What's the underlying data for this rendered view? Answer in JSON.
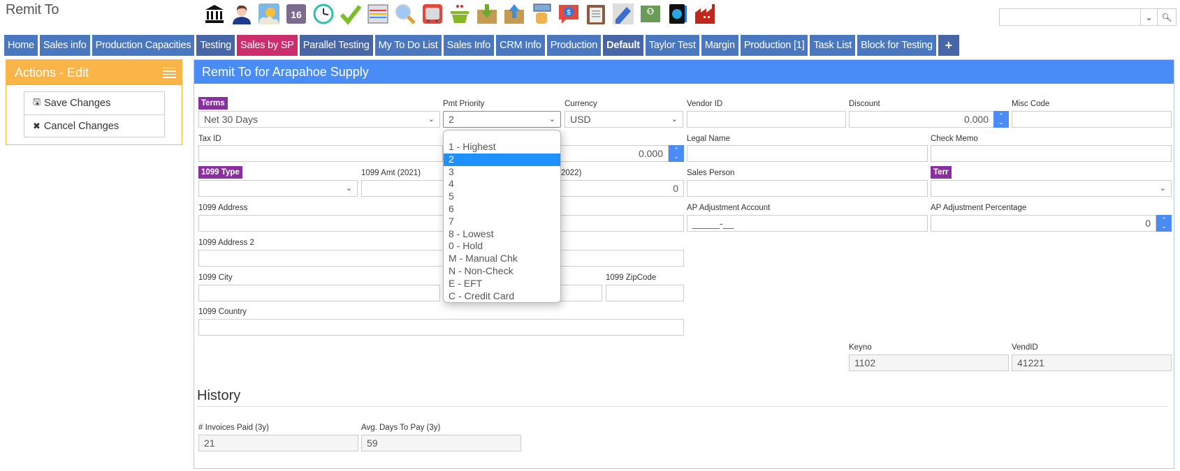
{
  "page_title": "Remit To",
  "toolbar_icons": [
    {
      "name": "bank-icon"
    },
    {
      "name": "user-icon"
    },
    {
      "name": "weather-icon"
    },
    {
      "name": "calendar-icon",
      "text": "16"
    },
    {
      "name": "clock-icon"
    },
    {
      "name": "checkmark-icon"
    },
    {
      "name": "schedule-board-icon"
    },
    {
      "name": "magnifier-icon"
    },
    {
      "name": "truck-icon"
    },
    {
      "name": "basket-icon"
    },
    {
      "name": "inbox-download-icon"
    },
    {
      "name": "outbox-upload-icon"
    },
    {
      "name": "hand-alert-icon"
    },
    {
      "name": "dollar-chat-icon"
    },
    {
      "name": "clipboard-icon"
    },
    {
      "name": "pencil-icon"
    },
    {
      "name": "money-icon"
    },
    {
      "name": "time-tablet-icon"
    },
    {
      "name": "factory-icon"
    }
  ],
  "search": {
    "value": "",
    "placeholder": ""
  },
  "tabs": [
    {
      "label": "Home"
    },
    {
      "label": "Sales info"
    },
    {
      "label": "Production Capacities"
    },
    {
      "label": "Testing"
    },
    {
      "label": "Sales by SP"
    },
    {
      "label": "Parallel Testing"
    },
    {
      "label": "My To Do List"
    },
    {
      "label": "Sales Info"
    },
    {
      "label": "CRM Info"
    },
    {
      "label": "Production"
    },
    {
      "label": "Default"
    },
    {
      "label": "Taylor Test"
    },
    {
      "label": "Margin"
    },
    {
      "label": "Production [1]"
    },
    {
      "label": "Task List"
    },
    {
      "label": "Block for Testing"
    },
    {
      "label": "+"
    }
  ],
  "actions": {
    "title": "Actions - Edit",
    "items": [
      {
        "label": "Save Changes",
        "icon": "save-icon"
      },
      {
        "label": "Cancel Changes",
        "icon": "close-icon"
      }
    ]
  },
  "form": {
    "title": "Remit To for Arapahoe Supply",
    "terms": {
      "label": "Terms",
      "value": "Net 30 Days"
    },
    "pmt_priority": {
      "label": "Pmt Priority",
      "value": "2",
      "options": [
        "",
        "1 - Highest",
        "2",
        "3",
        "4",
        "5",
        "6",
        "7",
        "8 - Lowest",
        "0 - Hold",
        "M - Manual Chk",
        "N - Non-Check",
        "E - EFT",
        "C - Credit Card"
      ],
      "selected_index": 2
    },
    "currency": {
      "label": "Currency",
      "value": "USD"
    },
    "vendor_id": {
      "label": "Vendor ID",
      "value": ""
    },
    "discount": {
      "label": "Discount",
      "value": "0.000"
    },
    "misc_code": {
      "label": "Misc Code",
      "value": ""
    },
    "tax_id": {
      "label": "Tax ID",
      "value": ""
    },
    "hidden_numeric": {
      "value": "0.000"
    },
    "legal_name": {
      "label": "Legal Name",
      "value": ""
    },
    "check_memo": {
      "label": "Check Memo",
      "value": ""
    },
    "type_1099": {
      "label": "1099 Type",
      "value": ""
    },
    "amt_1099_2021": {
      "label": "1099 Amt (2021)",
      "value": ""
    },
    "amt_1099_2022": {
      "label": "2022)",
      "value": "0"
    },
    "sales_person": {
      "label": "Sales Person",
      "value": ""
    },
    "terr": {
      "label": "Terr",
      "value": ""
    },
    "address_1099": {
      "label": "1099 Address",
      "value": ""
    },
    "ap_adj_account": {
      "label": "AP Adjustment Account",
      "value": "_____-__"
    },
    "ap_adj_percentage": {
      "label": "AP Adjustment Percentage",
      "value": "0"
    },
    "address2_1099": {
      "label": "1099 Address 2",
      "value": ""
    },
    "city_1099": {
      "label": "1099 City",
      "value": ""
    },
    "zip_1099": {
      "label": "1099 ZipCode",
      "value": ""
    },
    "country_1099": {
      "label": "1099 Country",
      "value": ""
    },
    "keyno": {
      "label": "Keyno",
      "value": "1102"
    },
    "vendid": {
      "label": "VendID",
      "value": "41221"
    }
  },
  "history": {
    "title": "History",
    "invoices_paid": {
      "label": "# Invoices Paid (3y)",
      "value": "21"
    },
    "avg_days_to_pay": {
      "label": "Avg. Days To Pay (3y)",
      "value": "59"
    }
  },
  "colors": {
    "tab": "#4a78c0",
    "tab_active_pink": "#cc2e6d",
    "header_blue": "#4a8cf5",
    "actions_orange": "#fbb448",
    "badge_purple": "#8a2fa0",
    "selected_option": "#1e90ff"
  }
}
